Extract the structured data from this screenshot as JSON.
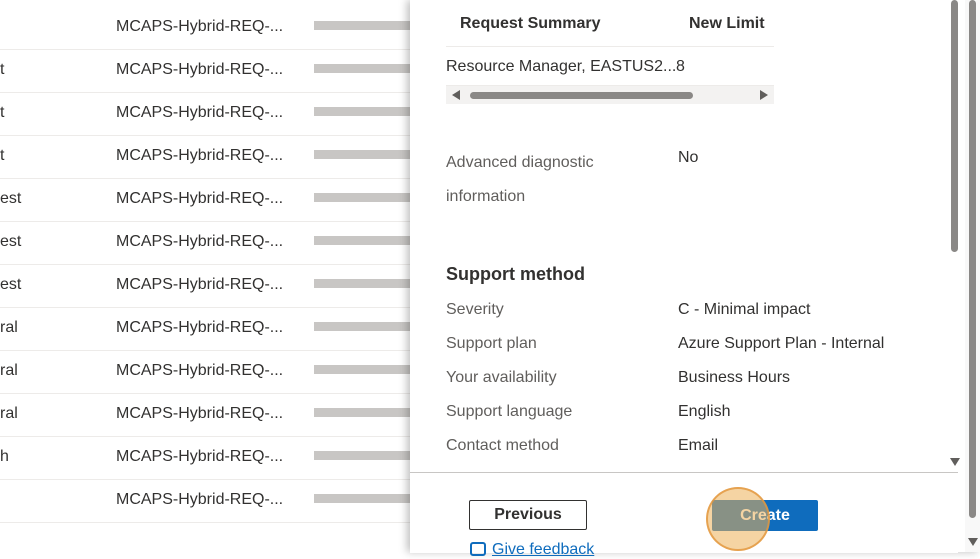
{
  "background_list": {
    "rows": [
      {
        "col1": "",
        "col2": "MCAPS-Hybrid-REQ-..."
      },
      {
        "col1": "t",
        "col2": "MCAPS-Hybrid-REQ-..."
      },
      {
        "col1": "t",
        "col2": "MCAPS-Hybrid-REQ-..."
      },
      {
        "col1": "t",
        "col2": "MCAPS-Hybrid-REQ-..."
      },
      {
        "col1": "est",
        "col2": "MCAPS-Hybrid-REQ-..."
      },
      {
        "col1": "est",
        "col2": "MCAPS-Hybrid-REQ-..."
      },
      {
        "col1": "est",
        "col2": "MCAPS-Hybrid-REQ-..."
      },
      {
        "col1": "ral",
        "col2": "MCAPS-Hybrid-REQ-..."
      },
      {
        "col1": "ral",
        "col2": "MCAPS-Hybrid-REQ-..."
      },
      {
        "col1": "ral",
        "col2": "MCAPS-Hybrid-REQ-..."
      },
      {
        "col1": "h",
        "col2": "MCAPS-Hybrid-REQ-..."
      },
      {
        "col1": "",
        "col2": "MCAPS-Hybrid-REQ-..."
      }
    ]
  },
  "summary_table": {
    "headers": [
      "Request Summary",
      "New Limit"
    ],
    "row": [
      "Resource Manager, EASTUS2...",
      "8"
    ]
  },
  "diagnostics": {
    "label": "Advanced diagnostic information",
    "value": "No"
  },
  "support_method": {
    "title": "Support method",
    "fields": [
      {
        "label": "Severity",
        "value": "C - Minimal impact"
      },
      {
        "label": "Support plan",
        "value": "Azure Support Plan - Internal"
      },
      {
        "label": "Your availability",
        "value": "Business Hours"
      },
      {
        "label": "Support language",
        "value": "English"
      },
      {
        "label": "Contact method",
        "value": "Email"
      }
    ]
  },
  "footer": {
    "previous_label": "Previous",
    "create_label": "Create",
    "feedback_label": "Give feedback"
  },
  "colors": {
    "accent": "#0f6cbd",
    "click_highlight": "#ecb058"
  }
}
